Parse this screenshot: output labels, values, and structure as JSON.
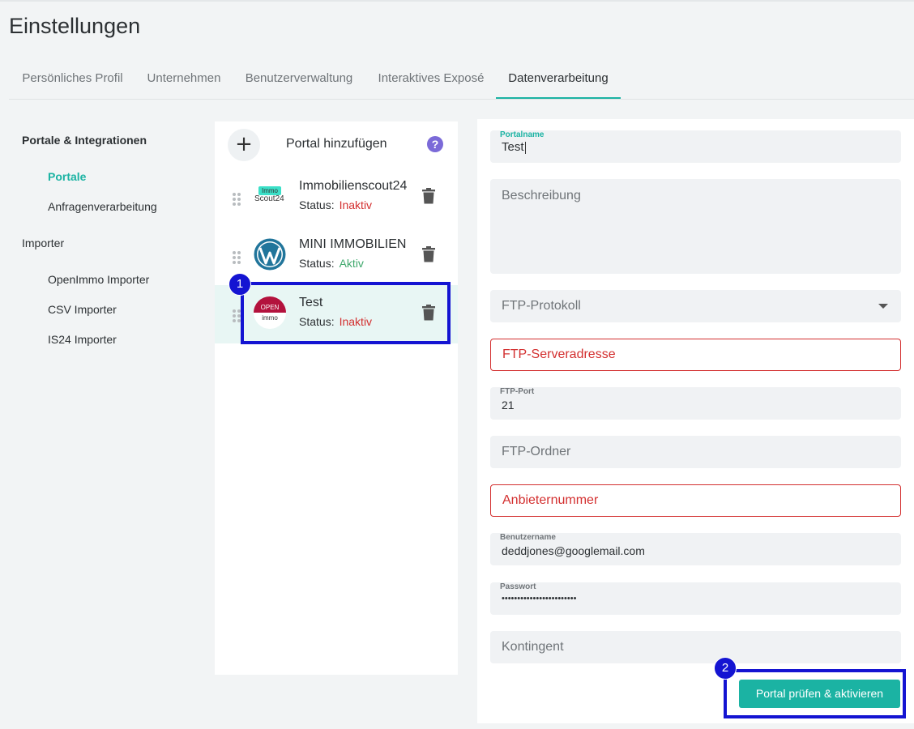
{
  "page": {
    "title": "Einstellungen"
  },
  "tabs": [
    {
      "label": "Persönliches Profil"
    },
    {
      "label": "Unternehmen"
    },
    {
      "label": "Benutzerverwaltung"
    },
    {
      "label": "Interaktives Exposé"
    },
    {
      "label": "Datenverarbeitung"
    }
  ],
  "sidebar": {
    "heading": "Portale & Integrationen",
    "items_portale": [
      "Portale",
      "Anfragenverarbeitung"
    ],
    "section_importer": "Importer",
    "items_importer": [
      "OpenImmo Importer",
      "CSV Importer",
      "IS24 Importer"
    ]
  },
  "portal_list": {
    "add_label": "Portal hinzufügen",
    "help_symbol": "?",
    "status_label": "Status:",
    "portals": [
      {
        "name": "Immobilienscout24",
        "status": "Inaktiv",
        "logo": "immoscout24-logo",
        "logo_text_top": "Immo",
        "logo_text_bottom": "Scout24"
      },
      {
        "name": "MINI IMMOBILIEN",
        "status": "Aktiv",
        "logo": "wordpress-logo"
      },
      {
        "name": "Test",
        "status": "Inaktiv",
        "logo": "openimmo-logo",
        "logo_text_top": "OPEN",
        "logo_text_bottom": "immo"
      }
    ]
  },
  "form": {
    "portalname_label": "Portalname",
    "portalname_value": "Test",
    "beschreibung_placeholder": "Beschreibung",
    "ftp_protokoll_placeholder": "FTP-Protokoll",
    "ftp_server_placeholder": "FTP-Serveradresse",
    "ftp_port_label": "FTP-Port",
    "ftp_port_value": "21",
    "ftp_ordner_placeholder": "FTP-Ordner",
    "anbieternummer_placeholder": "Anbieternummer",
    "benutzername_label": "Benutzername",
    "benutzername_value": "deddjones@googlemail.com",
    "passwort_label": "Passwort",
    "passwort_value": "••••••••••••••••••••••••",
    "kontingent_placeholder": "Kontingent",
    "submit_label": "Portal prüfen & aktivieren"
  },
  "annotations": {
    "badge1": "1",
    "badge2": "2"
  },
  "colors": {
    "accent": "#1bb3a3",
    "error": "#d32f2f",
    "active": "#3fa86c",
    "highlight": "#1414d2"
  }
}
